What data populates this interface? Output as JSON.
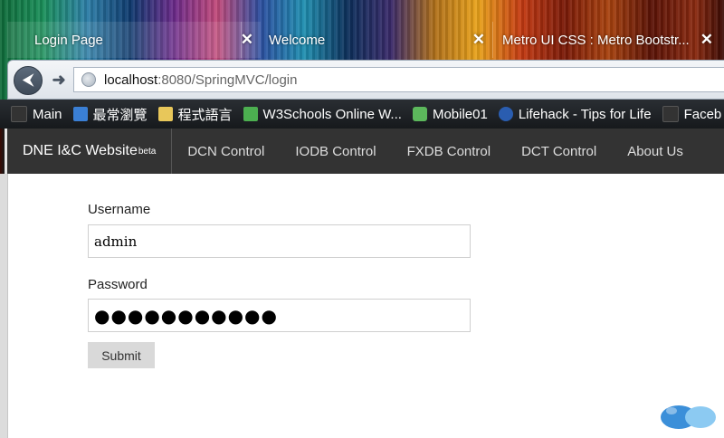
{
  "browser": {
    "tabs": [
      {
        "title": "Login Page",
        "active": true
      },
      {
        "title": "Welcome",
        "active": false
      },
      {
        "title": "Metro UI CSS : Metro Bootstr...",
        "active": false
      }
    ],
    "url": {
      "host": "localhost",
      "rest": ":8080/SpringMVC/login"
    },
    "bookmarks": [
      {
        "label": "Main",
        "icon": "folder-icon",
        "color": "#333333"
      },
      {
        "label": "最常瀏覽",
        "icon": "bookmark-list-icon",
        "color": "#3a7fd5"
      },
      {
        "label": "程式語言",
        "icon": "folder-icon",
        "color": "#e8c75a"
      },
      {
        "label": "W3Schools Online W...",
        "icon": "w3schools-icon",
        "color": "#4caf50"
      },
      {
        "label": "Mobile01",
        "icon": "mobile01-icon",
        "color": "#5cb85c"
      },
      {
        "label": "Lifehack - Tips for Life",
        "icon": "lifehack-icon",
        "color": "#2a5db0"
      },
      {
        "label": "Faceb",
        "icon": "folder-icon",
        "color": "#333333"
      }
    ]
  },
  "app": {
    "brand": "DNE I&C Website",
    "brand_sup": "beta",
    "nav": [
      "DCN Control",
      "IODB Control",
      "FXDB Control",
      "DCT Control",
      "About Us"
    ]
  },
  "form": {
    "username_label": "Username",
    "username_value": "admin",
    "password_label": "Password",
    "password_value": "●●●●●●●●●●●",
    "submit_label": "Submit"
  }
}
